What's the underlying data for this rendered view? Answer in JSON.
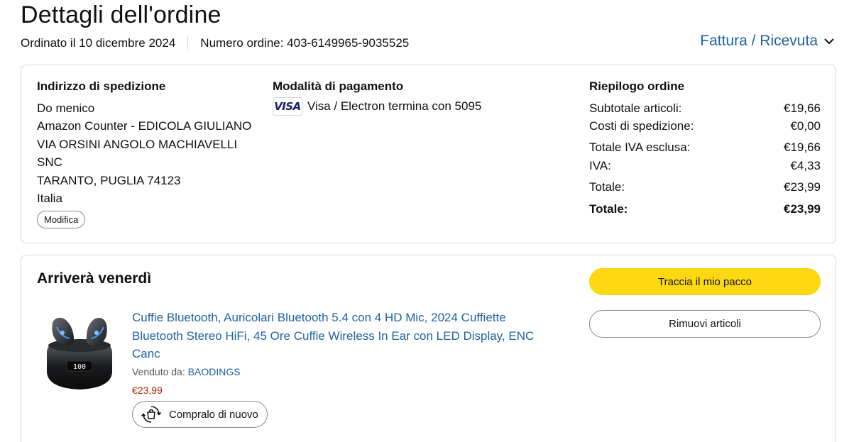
{
  "page": {
    "title": "Dettagli dell'ordine",
    "order_date": "Ordinato il 10 dicembre 2024",
    "order_number": "Numero ordine: 403-6149965-9035525",
    "invoice_link": "Fattura / Ricevuta"
  },
  "shipping": {
    "heading": "Indirizzo di spedizione",
    "lines": [
      "Do menico",
      "Amazon Counter - EDICOLA GIULIANO",
      "VIA ORSINI ANGOLO MACHIAVELLI",
      "SNC",
      "TARANTO, PUGLIA 74123",
      "Italia"
    ],
    "edit_button": "Modifica"
  },
  "payment": {
    "heading": "Modalità di pagamento",
    "card_brand": "VISA",
    "card_text": "Visa / Electron termina con 5095"
  },
  "summary": {
    "heading": "Riepilogo ordine",
    "rows": [
      {
        "label": "Subtotale articoli:",
        "value": "€19,66"
      },
      {
        "label": "Costi di spedizione:",
        "value": "€0,00"
      },
      {
        "label": "Totale IVA esclusa:",
        "value": "€19,66"
      },
      {
        "label": "IVA:",
        "value": "€4,33"
      },
      {
        "label": "Totale:",
        "value": "€23,99"
      },
      {
        "label": "Totale:",
        "value": "€23,99"
      }
    ]
  },
  "shipment": {
    "heading": "Arriverà venerdì",
    "product_title": "Cuffie Bluetooth, Auricolari Bluetooth 5.4 con 4 HD Mic, 2024 Cuffiette Bluetooth Stereo HiFi, 45 Ore Cuffie Wireless In Ear con LED Display, ENC Canc",
    "sold_by_label": "Venduto da: ",
    "seller": "BAODINGS",
    "price": "€23,99",
    "buy_again": "Compralo di nuovo",
    "track_button": "Traccia il mio pacco",
    "remove_button": "Rimuovi articoli"
  },
  "colors": {
    "link": "#2162a1",
    "price": "#b12704",
    "track_button": "#ffd814",
    "border": "#d5d9d9"
  },
  "icons": {
    "invoice_chevron": "chevron-down-icon",
    "buy_again": "buy-again-icon"
  }
}
